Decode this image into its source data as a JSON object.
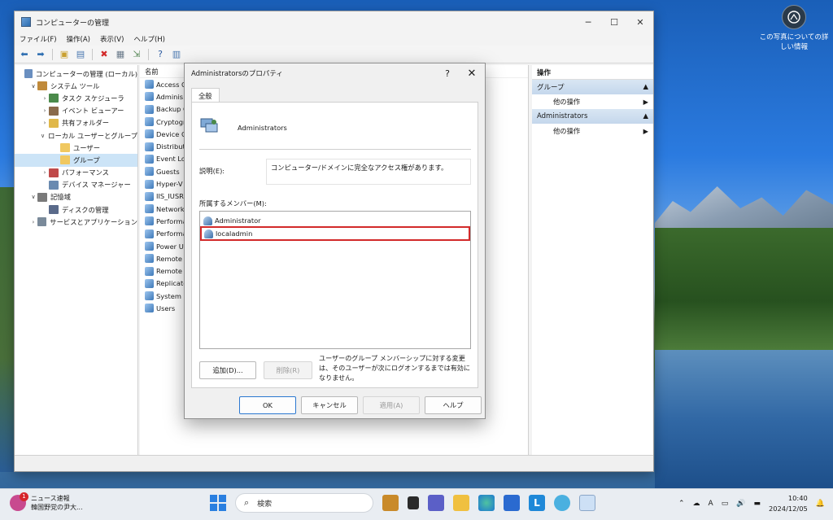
{
  "desktop": {
    "photo_info_line1": "この写真についての詳",
    "photo_info_line2": "しい情報"
  },
  "window": {
    "title": "コンピューターの管理",
    "menu": [
      "ファイル(F)",
      "操作(A)",
      "表示(V)",
      "ヘルプ(H)"
    ]
  },
  "tree": [
    {
      "label": "コンピューターの管理 (ローカル)",
      "level": 0,
      "arrow": "",
      "icon_color": "#6a8fc0"
    },
    {
      "label": "システム ツール",
      "level": 1,
      "arrow": "v",
      "icon_color": "#c08a3a"
    },
    {
      "label": "タスク スケジューラ",
      "level": 2,
      "arrow": ">",
      "icon_color": "#4a8a4a"
    },
    {
      "label": "イベント ビューアー",
      "level": 2,
      "arrow": ">",
      "icon_color": "#8a6a4a"
    },
    {
      "label": "共有フォルダー",
      "level": 2,
      "arrow": ">",
      "icon_color": "#e0b84a"
    },
    {
      "label": "ローカル ユーザーとグループ",
      "level": 2,
      "arrow": "v",
      "icon_color": "#5a7ab0"
    },
    {
      "label": "ユーザー",
      "level": 3,
      "arrow": "",
      "icon_color": "#f0c860"
    },
    {
      "label": "グループ",
      "level": 3,
      "arrow": "",
      "icon_color": "#f0c860"
    },
    {
      "label": "パフォーマンス",
      "level": 2,
      "arrow": ">",
      "icon_color": "#c04a4a"
    },
    {
      "label": "デバイス マネージャー",
      "level": 2,
      "arrow": "",
      "icon_color": "#6a8ab0"
    },
    {
      "label": "記憶域",
      "level": 1,
      "arrow": "v",
      "icon_color": "#7a7a7a"
    },
    {
      "label": "ディスクの管理",
      "level": 2,
      "arrow": "",
      "icon_color": "#5a6a8a"
    },
    {
      "label": "サービスとアプリケーション",
      "level": 1,
      "arrow": ">",
      "icon_color": "#7a8a9a"
    }
  ],
  "list": {
    "header": "名前",
    "items": [
      "Access C",
      "Adminis",
      "Backup C",
      "Cryptogr",
      "Device C",
      "Distribut",
      "Event Lo",
      "Guests",
      "Hyper-V",
      "IIS_IUSRS",
      "Network",
      "Performa",
      "Performa",
      "Power U",
      "Remote",
      "Remote",
      "Replicato",
      "System M",
      "Users"
    ]
  },
  "actions": {
    "header": "操作",
    "sections": [
      {
        "label": "グループ",
        "item": "他の操作"
      },
      {
        "label": "Administrators",
        "item": "他の操作"
      }
    ]
  },
  "dialog": {
    "title": "Administratorsのプロパティ",
    "help_glyph": "?",
    "tab": "全般",
    "group_name": "Administrators",
    "desc_label": "説明(E):",
    "desc_value": "コンピューター/ドメインに完全なアクセス権があります。",
    "members_label": "所属するメンバー(M):",
    "members": [
      "Administrator",
      "localadmin"
    ],
    "add_button": "追加(D)...",
    "remove_button": "削除(R)",
    "note": "ユーザーのグループ メンバーシップに対する変更は、そのユーザーが次にログオンするまでは有効になりません。",
    "ok": "OK",
    "cancel": "キャンセル",
    "apply": "適用(A)",
    "help": "ヘルプ"
  },
  "taskbar": {
    "news_badge": "1",
    "news_title": "ニュース速報",
    "news_sub": "韓国野党の尹大...",
    "search_placeholder": "検索",
    "ime": "A",
    "time": "10:40",
    "date": "2024/12/05"
  }
}
